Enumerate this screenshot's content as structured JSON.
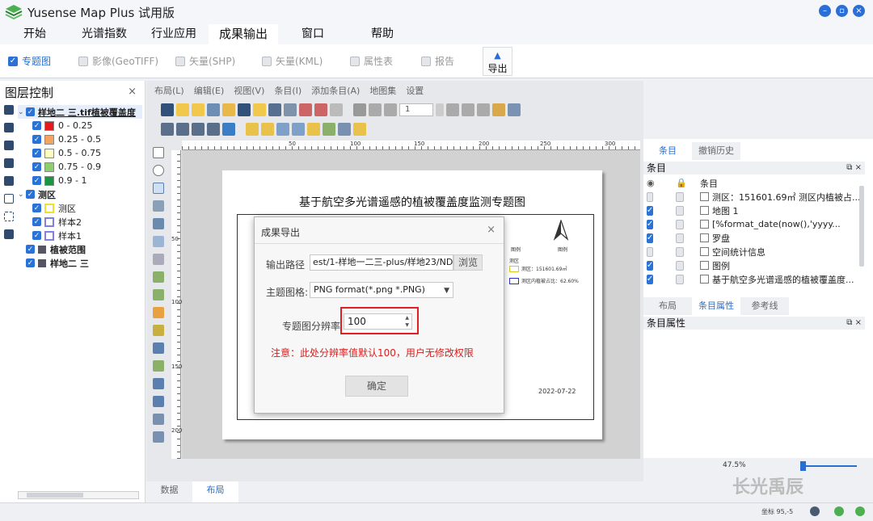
{
  "app": {
    "title": "Yusense Map Plus 试用版"
  },
  "menu_tabs": [
    "开始",
    "光谱指数",
    "行业应用",
    "成果输出",
    "窗口",
    "帮助"
  ],
  "ribbon": {
    "items": [
      {
        "label": "专题图",
        "checked": true
      },
      {
        "label": "影像(GeoTIFF)",
        "checked": false
      },
      {
        "label": "矢量(SHP)",
        "checked": false
      },
      {
        "label": "矢量(KML)",
        "checked": false
      },
      {
        "label": "属性表",
        "checked": false
      },
      {
        "label": "报告",
        "checked": false
      }
    ],
    "export_label": "导出"
  },
  "layer_panel": {
    "title": "图层控制",
    "close": "×",
    "layers": [
      {
        "label": "样地二 三.tif植被覆盖度",
        "bold": true
      },
      {
        "label": "0 - 0.25",
        "color": "#e41a1c"
      },
      {
        "label": "0.25 - 0.5",
        "color": "#f4a460"
      },
      {
        "label": "0.5 - 0.75",
        "color": "#ffffbf"
      },
      {
        "label": "0.75 - 0.9",
        "color": "#8fce6f"
      },
      {
        "label": "0.9 - 1",
        "color": "#1a9641"
      },
      {
        "label": "测区",
        "bold": true
      },
      {
        "label": "测区",
        "color": "#ffff66"
      },
      {
        "label": "样本2",
        "color": "#c8c8f8"
      },
      {
        "label": "样本1",
        "color": "#c8c8f8"
      },
      {
        "label": "植被范围",
        "bold": true
      },
      {
        "label": "样地二 三",
        "bold": true
      }
    ]
  },
  "layout_menu": [
    "布局(L)",
    "编辑(E)",
    "视图(V)",
    "条目(I)",
    "添加条目(A)",
    "地图集",
    "设置"
  ],
  "page_number": "1",
  "ruler_labels": {
    "h": [
      "50",
      "100",
      "150",
      "200",
      "250",
      "300"
    ],
    "v": [
      "50",
      "100",
      "150",
      "200"
    ]
  },
  "map_page": {
    "title": "基于航空多光谱遥感的植被覆盖度监测专题图",
    "legend_h1": "图例",
    "legend_h2": "图例",
    "legend_group": "测区",
    "legend_items": [
      "测区：151601.69㎡",
      "测区内植被占比：62.60%"
    ],
    "date": "2022-07-22"
  },
  "dialog": {
    "title": "成果导出",
    "close": "×",
    "path_label": "输出路径",
    "path_value": "est/1-样地一二三-plus/样地23/NDVI",
    "browse": "浏览",
    "format_label": "主题图格:",
    "format_value": "PNG format(*.png *.PNG)",
    "resolution_label": "专题图分辨率",
    "resolution_value": "100",
    "note": "注意：此处分辨率值默认100，用户无修改权限",
    "ok": "确定"
  },
  "bottom_tabs": [
    "数据",
    "布局"
  ],
  "right_panel": {
    "tabs_top": [
      "条目",
      "撤销历史"
    ],
    "items_header": "条目",
    "col_label": "条目",
    "items": [
      {
        "label": "测区：151601.69㎡ 测区内植被占...",
        "checked": false
      },
      {
        "label": "地图 1",
        "checked": true
      },
      {
        "label": "[%format_date(now(),'yyyy...",
        "checked": true
      },
      {
        "label": "罗盘",
        "checked": true
      },
      {
        "label": "空间统计信息",
        "checked": false
      },
      {
        "label": "图例",
        "checked": true
      },
      {
        "label": "基于航空多光谱遥感的植被覆盖度...",
        "checked": true
      }
    ],
    "tabs_mid": [
      "布局",
      "条目属性",
      "参考线"
    ],
    "props_header": "条目属性"
  },
  "zoom": "47.5%",
  "watermark": "长光禹辰",
  "status": {
    "coord_label": "坐标",
    "coord_value": "95,-5"
  }
}
